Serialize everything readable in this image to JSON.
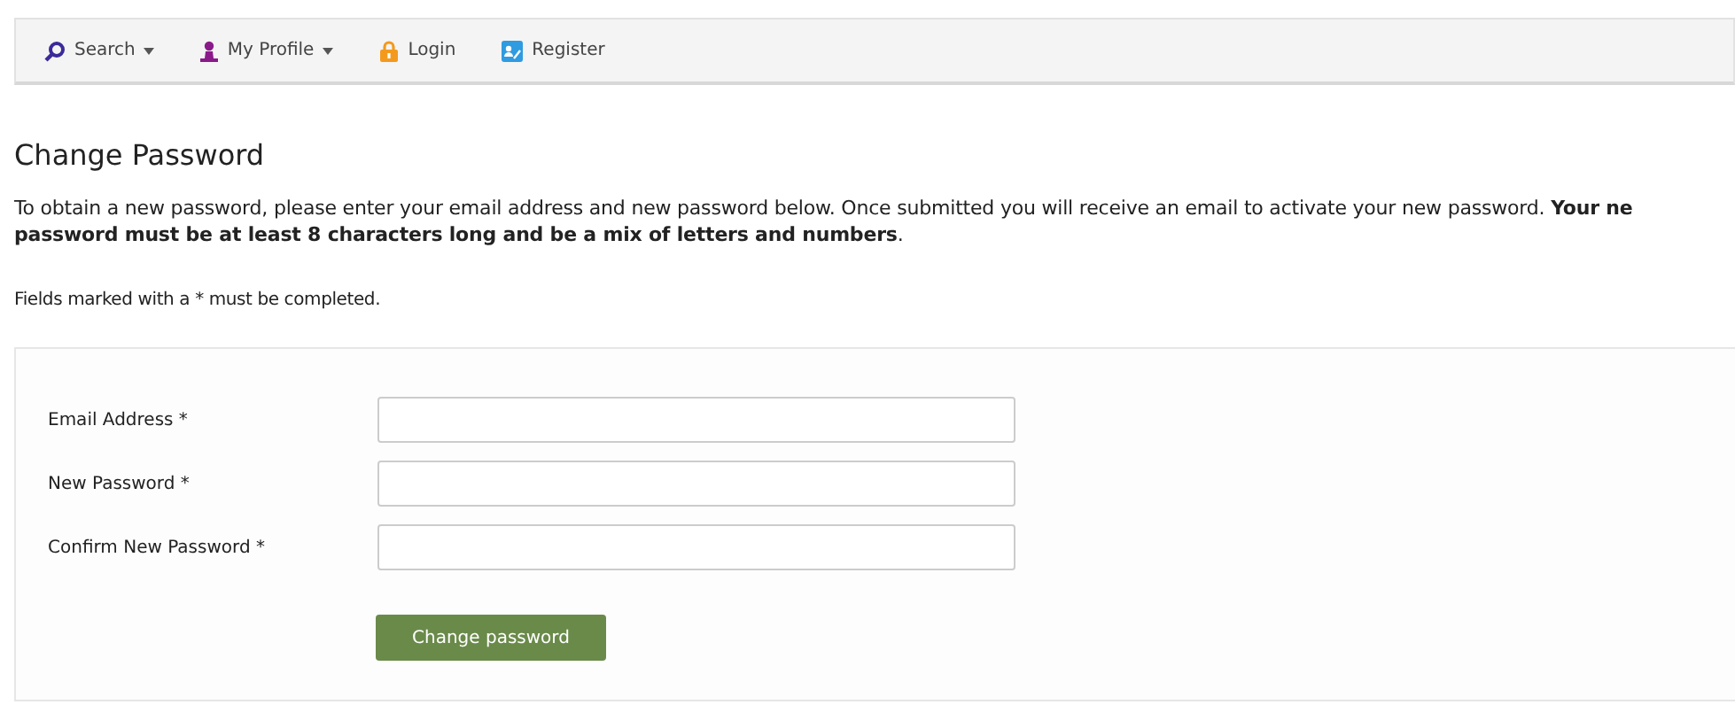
{
  "nav": [
    {
      "label": "Search",
      "kind": "search",
      "dropdown": true
    },
    {
      "label": "My Profile",
      "kind": "profile",
      "dropdown": true
    },
    {
      "label": "Login",
      "kind": "login",
      "dropdown": false
    },
    {
      "label": "Register",
      "kind": "register",
      "dropdown": false
    }
  ],
  "title": "Change Password",
  "intro": "To obtain a new password, please enter your email address and new password below. Once submitted you will receive an email to activate your new password. **Your ne**\n**password must be at least 8 characters long and be a mix of letters and numbers**.",
  "note": "Fields marked with a * must be completed.",
  "fields": [
    {
      "label": "Email Address *"
    },
    {
      "label": "New Password *"
    },
    {
      "label": "Confirm New Password *"
    }
  ],
  "submit": "Change password"
}
